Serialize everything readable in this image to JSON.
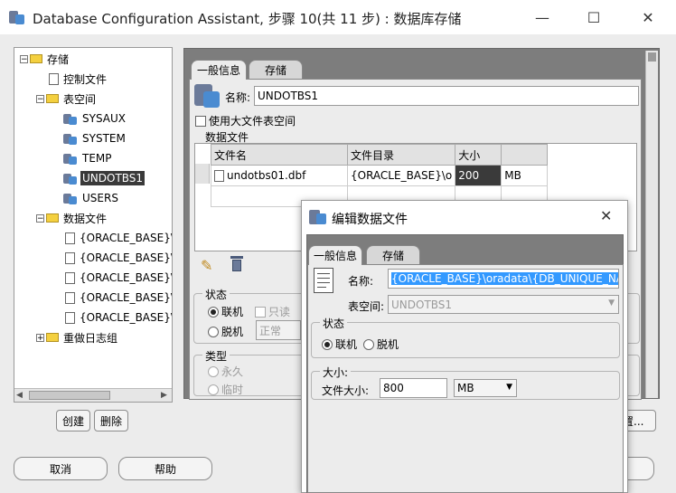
{
  "window": {
    "title": "Database Configuration Assistant, 步骤 10(共 11 步) : 数据库存储",
    "minimize": "—",
    "maximize": "☐",
    "close": "✕"
  },
  "tree": {
    "nodes": [
      {
        "label": "存储",
        "exp": "−"
      },
      {
        "label": "控制文件"
      },
      {
        "label": "表空间",
        "exp": "−"
      },
      {
        "label": "SYSAUX"
      },
      {
        "label": "SYSTEM"
      },
      {
        "label": "TEMP"
      },
      {
        "label": "UNDOTBS1"
      },
      {
        "label": "USERS"
      },
      {
        "label": "数据文件",
        "exp": "−"
      },
      {
        "label": "{ORACLE_BASE}\\o"
      },
      {
        "label": "{ORACLE_BASE}\\o"
      },
      {
        "label": "{ORACLE_BASE}\\o"
      },
      {
        "label": "{ORACLE_BASE}\\o"
      },
      {
        "label": "{ORACLE_BASE}\\o"
      },
      {
        "label": "重做日志组",
        "exp": "+"
      }
    ]
  },
  "buttons": {
    "create": "创建",
    "delete": "删除",
    "cancel": "取消",
    "help": "帮助",
    "params_partial": "置..."
  },
  "main": {
    "tabs": [
      "一般信息",
      "存储"
    ],
    "name_label": "名称:",
    "name_value": "UNDOTBS1",
    "bigfile_label": "使用大文件表空间",
    "datafiles_label": "数据文件",
    "table_headers": [
      "文件名",
      "文件目录",
      "大小",
      ""
    ],
    "table_rows": [
      [
        "undotbs01.dbf",
        "{ORACLE_BASE}\\o",
        "200",
        "MB"
      ]
    ],
    "status_label": "状态",
    "online_label": "联机",
    "readonly_label": "只读",
    "offline_label": "脱机",
    "offline_mode": "正常",
    "type_label": "类型",
    "permanent_label": "永久",
    "temporary_label": "临时"
  },
  "dialog": {
    "title": "编辑数据文件",
    "tabs": [
      "一般信息",
      "存储"
    ],
    "name_label": "名称:",
    "name_value": "{ORACLE_BASE}\\oradata\\{DB_UNIQUE_NAM",
    "tablespace_label": "表空间:",
    "tablespace_value": "UNDOTBS1",
    "status_label": "状态",
    "online_label": "联机",
    "offline_label": "脱机",
    "size_group_label": "大小:",
    "filesize_label": "文件大小:",
    "filesize_value": "800",
    "unit_value": "MB"
  },
  "colors": {
    "selection": "#3a3a3a",
    "highlight": "#3399ff",
    "folder": "#f4d03f"
  }
}
